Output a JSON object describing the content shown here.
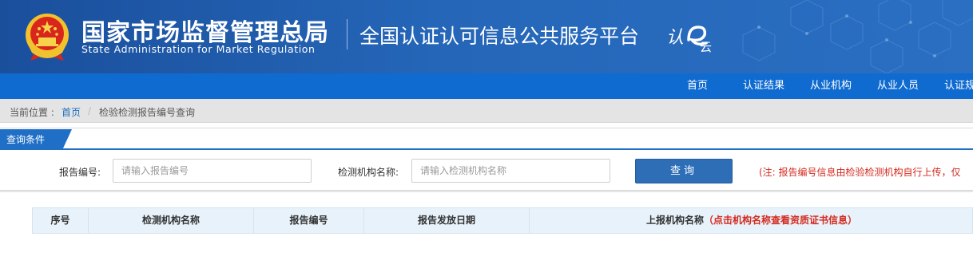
{
  "header": {
    "org_name_cn": "国家市场监督管理总局",
    "org_name_en": "State Administration  for  Market Regulation",
    "platform_name": "全国认证认可信息公共服务平台",
    "logo_text": "认e云"
  },
  "nav": {
    "items": [
      {
        "label": "首页"
      },
      {
        "label": "认证结果"
      },
      {
        "label": "从业机构"
      },
      {
        "label": "从业人员"
      },
      {
        "label": "认证规"
      }
    ]
  },
  "breadcrumb": {
    "label": "当前位置 :",
    "home": "首页",
    "separator": "/",
    "current": "检验检测报告编号查询"
  },
  "query": {
    "tab_label": "查询条件",
    "report_no_label": "报告编号:",
    "report_no_placeholder": "请输入报告编号",
    "report_no_value": "",
    "org_name_label": "检测机构名称:",
    "org_name_placeholder": "请输入检测机构名称",
    "org_name_value": "",
    "button_label": "查询",
    "note": "(注: 报告编号信息由检验检测机构自行上传，仅"
  },
  "table": {
    "columns": [
      {
        "label": "序号"
      },
      {
        "label": "检测机构名称"
      },
      {
        "label": "报告编号"
      },
      {
        "label": "报告发放日期"
      },
      {
        "label": "上报机构名称",
        "hint": "（点击机构名称查看资质证书信息）"
      }
    ],
    "rows": []
  },
  "colors": {
    "header_bg": "#1a4f9c",
    "nav_bg": "#0f6bd0",
    "button_bg": "#2d6eb7",
    "note_red": "#d42a1f",
    "table_header_bg": "#e8f2fa"
  }
}
